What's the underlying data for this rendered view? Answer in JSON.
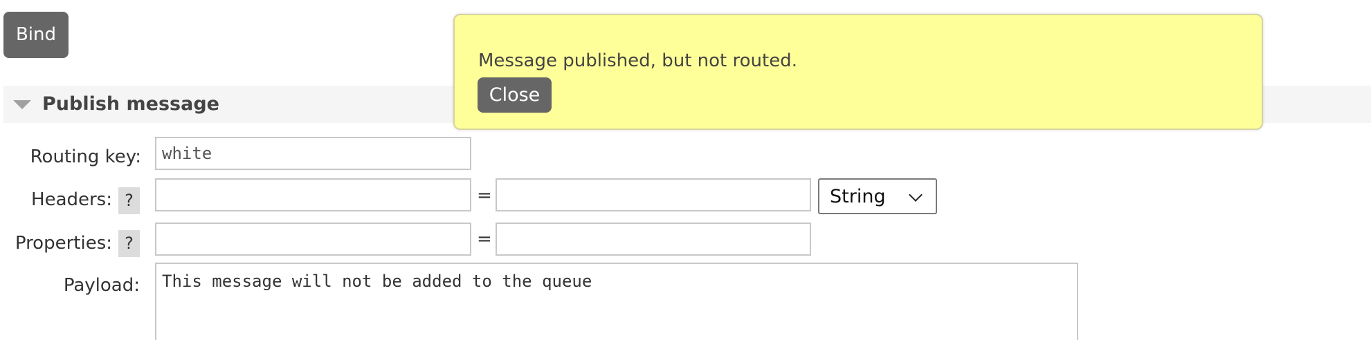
{
  "bind_button": {
    "label": "Bind"
  },
  "publish_section": {
    "title": "Publish message",
    "routing_key": {
      "label": "Routing key:",
      "placeholder": "white",
      "value": ""
    },
    "headers": {
      "label": "Headers:",
      "help": "?",
      "key_value": "",
      "equals": "=",
      "value_value": "",
      "type_selected": "String"
    },
    "properties": {
      "label": "Properties:",
      "help": "?",
      "key_value": "",
      "equals": "=",
      "value_value": ""
    },
    "payload": {
      "label": "Payload:",
      "value": "This message will not be added to the queue"
    }
  },
  "notification": {
    "message": "Message published, but not routed.",
    "close_label": "Close"
  },
  "colors": {
    "button_bg": "#666666",
    "toast_bg": "#ffff99",
    "section_header_bg": "#f5f5f5",
    "help_bg": "#dcdcdc"
  },
  "icons": {
    "section_toggle": "triangle-down-icon",
    "select_arrow": "chevron-down-icon"
  }
}
